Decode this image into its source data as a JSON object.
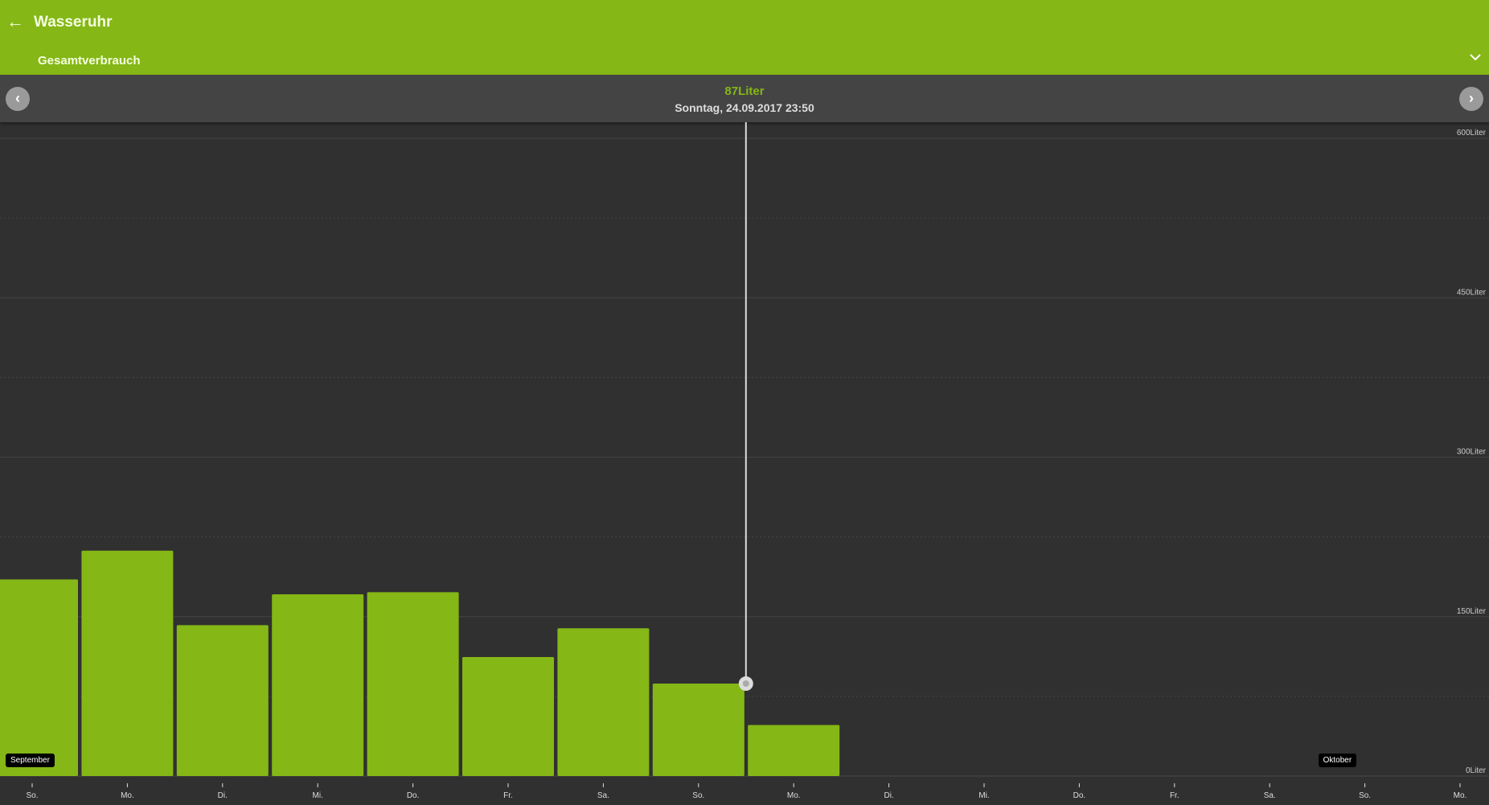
{
  "header": {
    "title": "Wasseruhr",
    "subtitle": "Gesamtverbrauch"
  },
  "selection": {
    "value": "87Liter",
    "date": "Sonntag, 24.09.2017 23:50"
  },
  "colors": {
    "accent": "#85b716",
    "bg": "#303030"
  },
  "chart_data": {
    "type": "bar",
    "categories": [
      "So.",
      "Mo.",
      "Di.",
      "Mi.",
      "Do.",
      "Fr.",
      "Sa.",
      "So.",
      "Mo.",
      "Di.",
      "Mi.",
      "Do.",
      "Fr.",
      "Sa.",
      "So.",
      "Mo."
    ],
    "values": [
      185,
      212,
      142,
      171,
      173,
      112,
      139,
      87,
      48,
      null,
      null,
      null,
      null,
      null,
      null,
      null
    ],
    "ylim": [
      0,
      600
    ],
    "yticks": [
      0,
      150,
      300,
      450,
      600
    ],
    "ytick_labels": [
      "0Liter",
      "150Liter",
      "300Liter",
      "450Liter",
      "600Liter"
    ],
    "month_labels": [
      {
        "label": "September",
        "index": 0
      },
      {
        "label": "Oktober",
        "index": 14
      }
    ],
    "selected_index": 7,
    "grid": true
  }
}
